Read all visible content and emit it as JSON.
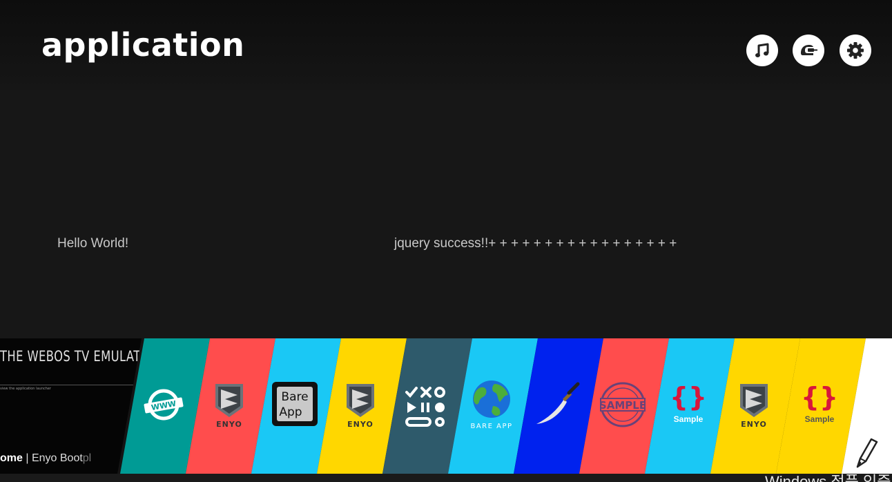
{
  "header": {
    "title": "application"
  },
  "top_icons": [
    {
      "name": "music-icon"
    },
    {
      "name": "input-icon"
    },
    {
      "name": "settings-icon"
    }
  ],
  "content": {
    "left_text": "Hello World!",
    "right_text": "jquery success!!+ + + + + + + + + + + + + + + + +"
  },
  "recent": {
    "title": "THE WEBOS TV EMULATOR",
    "subtitle": "view the application launcher",
    "footer_bold": "ome",
    "footer_sep": " | Enyo Boot",
    "footer_tail": "pl"
  },
  "launcher": {
    "colors": {
      "teal": "#009b95",
      "red": "#ff4d4d",
      "cyan": "#1ac8f5",
      "yellow": "#ffd700",
      "slate": "#2e5a6b",
      "blue": "#0022ee",
      "white": "#ffffff"
    },
    "apps": [
      {
        "name": "www-app",
        "color": "#009b95",
        "icon": "www",
        "label": "WWW"
      },
      {
        "name": "enyo-app-1",
        "color": "#ff4d4d",
        "icon": "enyo",
        "label": "ENYO"
      },
      {
        "name": "bare-app-1",
        "color": "#1ac8f5",
        "icon": "bare",
        "label": "Bare App"
      },
      {
        "name": "enyo-app-2",
        "color": "#ffd700",
        "icon": "enyo",
        "label": "ENYO"
      },
      {
        "name": "media-controls-app",
        "color": "#2e5a6b",
        "icon": "controls",
        "label": ""
      },
      {
        "name": "bare-app-globe",
        "color": "#1ac8f5",
        "icon": "globe",
        "label": "BARE APP"
      },
      {
        "name": "sword-app",
        "color": "#0022ee",
        "icon": "sword",
        "label": ""
      },
      {
        "name": "sample-stamp-app",
        "color": "#ff4d4d",
        "icon": "stamp",
        "label": "SAMPLE"
      },
      {
        "name": "sample-app-1",
        "color": "#1ac8f5",
        "icon": "braces",
        "label": "Sample"
      },
      {
        "name": "enyo-app-3",
        "color": "#ffd700",
        "icon": "enyo",
        "label": "ENYO"
      },
      {
        "name": "sample-app-2",
        "color": "#ffd700",
        "icon": "braces",
        "label": "Sample"
      },
      {
        "name": "edit-launcher",
        "color": "#ffffff",
        "icon": "pencil",
        "label": ""
      }
    ]
  },
  "bottom_strip": {
    "text": "Windows 정품 인증"
  }
}
